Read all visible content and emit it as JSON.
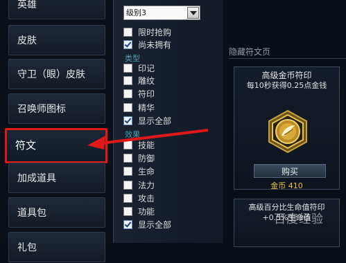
{
  "sidebar": {
    "items": [
      {
        "label": "英雄"
      },
      {
        "label": "皮肤"
      },
      {
        "label": "守卫（眼）皮肤"
      },
      {
        "label": "召唤师图标"
      },
      {
        "label": "符文"
      },
      {
        "label": "加成道具"
      },
      {
        "label": "道具包"
      },
      {
        "label": "礼包"
      }
    ],
    "active_index": 4
  },
  "filter": {
    "level_select": {
      "value": "级别3"
    },
    "options": [
      {
        "label": "限时抢购",
        "checked": false
      },
      {
        "label": "尚未拥有",
        "checked": true
      }
    ],
    "type_section": "类型",
    "types": [
      {
        "label": "印记",
        "checked": false
      },
      {
        "label": "雕纹",
        "checked": false
      },
      {
        "label": "符印",
        "checked": false
      },
      {
        "label": "精华",
        "checked": false
      },
      {
        "label": "显示全部",
        "checked": true
      }
    ],
    "effect_section": "效果",
    "effects": [
      {
        "label": "技能",
        "checked": false
      },
      {
        "label": "防御",
        "checked": false
      },
      {
        "label": "生命",
        "checked": false
      },
      {
        "label": "法力",
        "checked": false
      },
      {
        "label": "攻击",
        "checked": false
      },
      {
        "label": "功能",
        "checked": false
      },
      {
        "label": "显示全部",
        "checked": true
      }
    ]
  },
  "store": {
    "section_title": "隐藏符文页",
    "cards": [
      {
        "title": "高级金币符印",
        "desc": "每10秒获得0.25点金钱",
        "buy_label": "购买",
        "price": "金币 410"
      },
      {
        "title": "高级百分比生命值符印",
        "desc": "+0.5%生命值"
      }
    ]
  },
  "watermark": "百度经验",
  "colors": {
    "accent_red": "#e01818",
    "gold": "#e8c13a",
    "section_teal": "#4d9fb0"
  }
}
